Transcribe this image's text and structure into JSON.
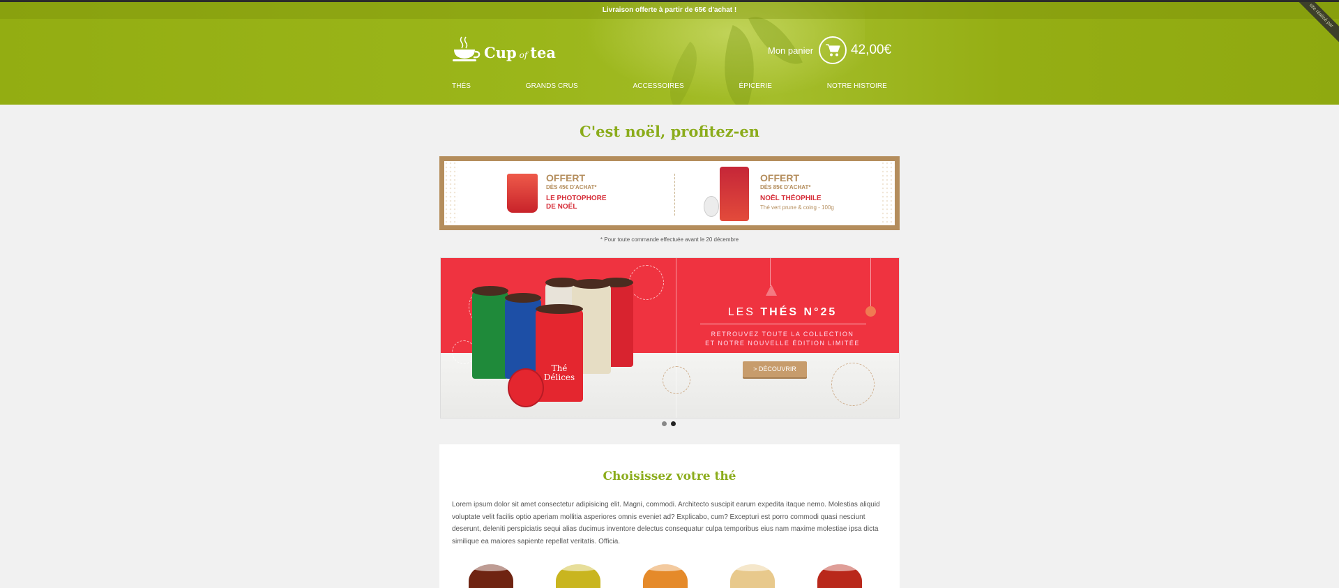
{
  "promo_strip": {
    "text": "Livraison offerte à partir de 65€ d'achat !"
  },
  "corner_ribbon": {
    "text": "site réalisé par"
  },
  "logo": {
    "brand_cup": "Cup",
    "brand_of": "of",
    "brand_tea": "tea"
  },
  "cart": {
    "label": "Mon panier",
    "amount": "42,00€"
  },
  "nav": {
    "items": [
      "Thés",
      "Grands crus",
      "Accessoires",
      "Épicerie",
      "Notre histoire"
    ]
  },
  "hero": {
    "title": "C'est noël, profitez-en"
  },
  "offers": [
    {
      "title": "OFFERT",
      "subtitle": "DÈS 45€ D'ACHAT*",
      "product_line1": "LE PHOTOPHORE",
      "product_line2": "DE NOËL",
      "detail": ""
    },
    {
      "title": "OFFERT",
      "subtitle": "DÈS 85€ D'ACHAT*",
      "product_line1": "NOËL THÉOPHILE",
      "product_line2": "",
      "detail": "Thé vert prune & coing - 100g"
    }
  ],
  "footnote": "* Pour toute commande effectuée avant le 20 décembre",
  "slider": {
    "title_prefix": "LES",
    "title_bold": "THÉS N°25",
    "subtitle_line1": "RETROUVEZ TOUTE LA COLLECTION",
    "subtitle_line2": "ET NOTRE NOUVELLE ÉDITION LIMITÉE",
    "button": "> DÉCOUVRIR",
    "can_label": "Thé Délices",
    "slide_count": 2,
    "active_slide": 2
  },
  "section": {
    "title": "Choisissez votre thé",
    "body": "Lorem ipsum dolor sit amet consectetur adipisicing elit. Magni, commodi. Architecto suscipit earum expedita itaque nemo. Molestias aliquid voluptate velit facilis optio aperiam mollitia asperiores omnis eveniet ad? Explicabo, cum? Excepturi est porro commodi quasi nesciunt deserunt, deleniti perspiciatis sequi alias ducimus inventore delectus consequatur culpa temporibus eius nam maxime molestiae ipsa dicta similique ea maiores sapiente repellat veritatis. Officia."
  },
  "colors": {
    "brand_green": "#8bac1b",
    "header_green": "#9bb61a",
    "slide_red": "#ef3340",
    "gold": "#b48d5c",
    "button_tan": "#c79c6c"
  },
  "icons": [
    "tea-cup-logo-icon",
    "shopping-cart-icon"
  ]
}
